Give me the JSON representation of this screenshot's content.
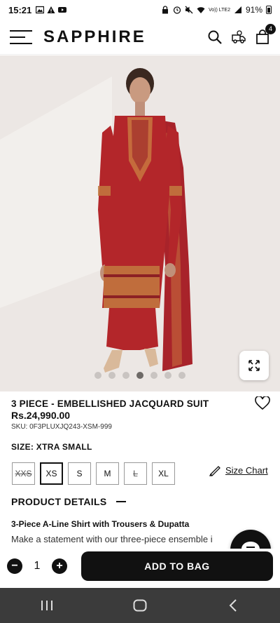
{
  "status_bar": {
    "time": "15:21",
    "battery": "91%",
    "network": "Vo)) LTE2"
  },
  "header": {
    "logo": "SAPPHIRE",
    "cart_count": "4"
  },
  "gallery": {
    "dot_count": 7,
    "active_index": 3
  },
  "product": {
    "title": "3 PIECE - EMBELLISHED JACQUARD SUIT",
    "price": "Rs.24,990.00",
    "sku": "SKU: 0F3PLUXJQ243-XSM-999",
    "size_label": "SIZE: XTRA SMALL",
    "sizes": [
      {
        "label": "XXS",
        "available": false,
        "selected": false
      },
      {
        "label": "XS",
        "available": true,
        "selected": true
      },
      {
        "label": "S",
        "available": true,
        "selected": false
      },
      {
        "label": "M",
        "available": true,
        "selected": false
      },
      {
        "label": "L",
        "available": false,
        "selected": false
      },
      {
        "label": "XL",
        "available": true,
        "selected": false
      }
    ],
    "size_chart": "Size Chart",
    "details_heading": "PRODUCT DETAILS",
    "details_subtitle": "3-Piece A-Line Shirt with Trousers & Dupatta",
    "details_text": "Make a statement with our three-piece ensemble i"
  },
  "cart": {
    "quantity": "1",
    "minus": "−",
    "plus": "+",
    "add_label": "ADD TO BAG"
  },
  "colors": {
    "accent": "#111111",
    "image_bg": "#efebe8",
    "dress": "#b3262a"
  }
}
